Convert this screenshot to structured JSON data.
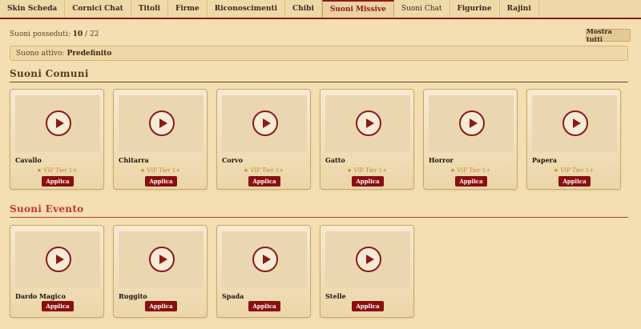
{
  "tabs": [
    {
      "label": "Skin Scheda"
    },
    {
      "label": "Cornici Chat"
    },
    {
      "label": "Titoli"
    },
    {
      "label": "Firme"
    },
    {
      "label": "Riconoscimenti"
    },
    {
      "label": "Chibi"
    },
    {
      "label": "Suoni Missive"
    },
    {
      "label": "Suoni Chat"
    },
    {
      "label": "Figurine"
    },
    {
      "label": "Rajini"
    }
  ],
  "owned": {
    "label": "Suoni posseduti:",
    "count": "10",
    "separator": "/",
    "total": "22"
  },
  "show_all_label": "Mostra tutti",
  "active_sound": {
    "label": "Suono attivo:",
    "value": "Predefinito"
  },
  "sections": {
    "common": {
      "title": "Suoni Comuni",
      "cards": [
        {
          "name": "Cavallo",
          "vip": "★ VIP Tier 1+",
          "apply": "Applica"
        },
        {
          "name": "Chitarra",
          "vip": "★ VIP Tier 1+",
          "apply": "Applica"
        },
        {
          "name": "Corvo",
          "vip": "★ VIP Tier 1+",
          "apply": "Applica"
        },
        {
          "name": "Gatto",
          "vip": "★ VIP Tier 1+",
          "apply": "Applica"
        },
        {
          "name": "Horror",
          "vip": "★ VIP Tier 1+",
          "apply": "Applica"
        },
        {
          "name": "Papera",
          "vip": "★ VIP Tier 1+",
          "apply": "Applica"
        }
      ]
    },
    "event": {
      "title": "Suoni Evento",
      "cards": [
        {
          "name": "Dardo Magico",
          "apply": "Applica"
        },
        {
          "name": "Ruggito",
          "apply": "Applica"
        },
        {
          "name": "Spada",
          "apply": "Applica"
        },
        {
          "name": "Stelle",
          "apply": "Applica"
        }
      ]
    }
  },
  "icons": {
    "play": "play-icon",
    "star": "star-icon"
  },
  "colors": {
    "accent": "#8b1a1a",
    "event_title": "#c0392b",
    "vip": "#c08a2a",
    "background": "#f4dfb2"
  }
}
